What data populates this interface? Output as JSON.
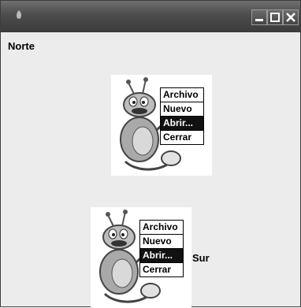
{
  "window": {
    "title": "",
    "title_bar_color": "#4a4a4a",
    "background": "#ececec"
  },
  "north": {
    "label": "Norte"
  },
  "south": {
    "label": "Sur"
  },
  "illustrations": [
    {
      "menu": [
        {
          "label": "Archivo",
          "selected": false
        },
        {
          "label": "Nuevo",
          "selected": false
        },
        {
          "label": "Abrir...",
          "selected": true
        },
        {
          "label": "Cerrar",
          "selected": false
        }
      ]
    },
    {
      "menu": [
        {
          "label": "Archivo",
          "selected": false
        },
        {
          "label": "Nuevo",
          "selected": false
        },
        {
          "label": "Abrir...",
          "selected": true
        },
        {
          "label": "Cerrar",
          "selected": false
        }
      ]
    }
  ]
}
